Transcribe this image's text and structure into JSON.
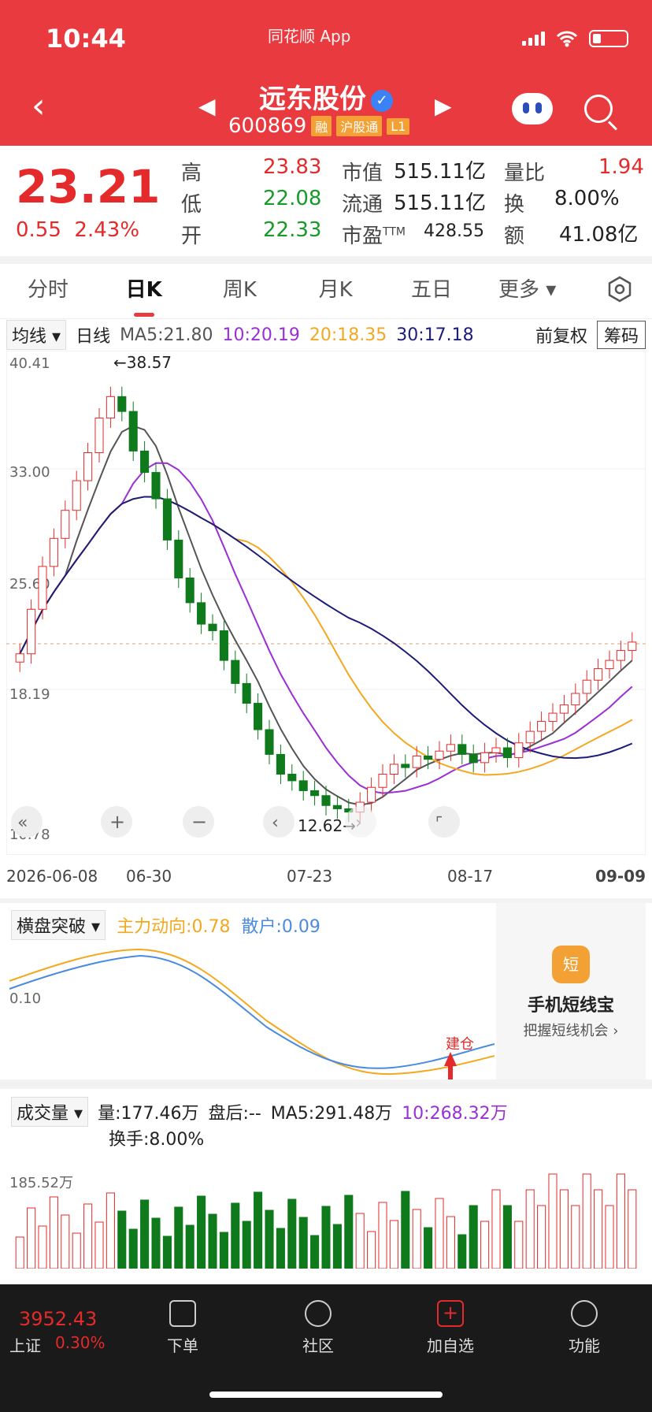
{
  "status": {
    "time": "10:44",
    "app": "同花顺 App"
  },
  "header": {
    "name": "远东股份",
    "code": "600869",
    "tags": [
      "融",
      "沪股通",
      "L1"
    ]
  },
  "quote": {
    "price": "23.21",
    "change": "0.55",
    "pct": "2.43%",
    "high_label": "高",
    "high": "23.83",
    "low_label": "低",
    "low": "22.08",
    "open_label": "开",
    "open": "22.33",
    "mcap_label": "市值",
    "mcap": "515.11亿",
    "float_label": "流通",
    "float": "515.11亿",
    "pe_label": "市盈",
    "pe_sup": "TTM",
    "pe": "428.55",
    "vr_label": "量比",
    "vr": "1.94",
    "turn_label": "换",
    "turn": "8.00%",
    "amt_label": "额",
    "amt": "41.08亿"
  },
  "tabs": [
    "分时",
    "日K",
    "周K",
    "月K",
    "五日",
    "更多"
  ],
  "ma": {
    "selector": "均线",
    "period": "日线",
    "ma5": "MA5:21.80",
    "ma10": "10:20.19",
    "ma20": "20:18.35",
    "ma30": "30:17.18",
    "adj": "前复权",
    "chip": "筹码"
  },
  "kchart_labels": {
    "y1": "40.41",
    "y2": "33.00",
    "y3": "25.60",
    "y4": "18.19",
    "y5": "10.78",
    "hi": "←38.57",
    "lo": "12.62→"
  },
  "dates": [
    "2026-06-08",
    "06-30",
    "07-23",
    "08-17",
    "09-09"
  ],
  "indicator": {
    "name": "横盘突破",
    "main": "主力动向:0.78",
    "retail": "散户:0.09",
    "y": "0.10",
    "signal": "建仓"
  },
  "ad": {
    "title": "手机短线宝",
    "sub": "把握短线机会",
    "icon": "短"
  },
  "volume": {
    "name": "成交量",
    "vol": "量:177.46万",
    "after": "盘后:--",
    "ma5": "MA5:291.48万",
    "ma10": "10:268.32万",
    "turn": "换手:8.00%",
    "y": "185.52万"
  },
  "bottom": {
    "idx": "3952.43",
    "idx_name": "上证",
    "idx_chg": "0.30%",
    "nav": [
      "下单",
      "社区",
      "加自选",
      "功能"
    ]
  },
  "colors": {
    "up": "#e42a2a",
    "down": "#0e7a1c",
    "ma5": "#555555",
    "ma10": "#9b2fd6",
    "ma20": "#f3a81f",
    "ma30": "#1c1c7a"
  },
  "chart_data": {
    "type": "candlestick",
    "dates": [
      "2026-06-08",
      "06-30",
      "07-23",
      "08-17",
      "09-09"
    ],
    "ylim": [
      10.78,
      40.41
    ],
    "high_marker": 38.57,
    "low_marker": 12.62,
    "close": [
      22.5,
      25.2,
      27.8,
      29.5,
      31.2,
      33.0,
      34.7,
      36.8,
      38.1,
      37.2,
      34.8,
      33.5,
      31.9,
      29.4,
      27.1,
      25.6,
      24.3,
      23.9,
      22.1,
      20.7,
      19.5,
      17.9,
      16.4,
      15.2,
      14.8,
      14.2,
      13.9,
      13.3,
      13.1,
      12.9,
      13.5,
      14.4,
      15.2,
      15.8,
      15.6,
      16.3,
      16.1,
      16.6,
      17.0,
      16.4,
      15.9,
      16.5,
      16.8,
      16.2,
      17.1,
      17.8,
      18.4,
      18.9,
      19.4,
      20.1,
      20.9,
      21.6,
      22.1,
      22.7,
      23.21
    ]
  }
}
